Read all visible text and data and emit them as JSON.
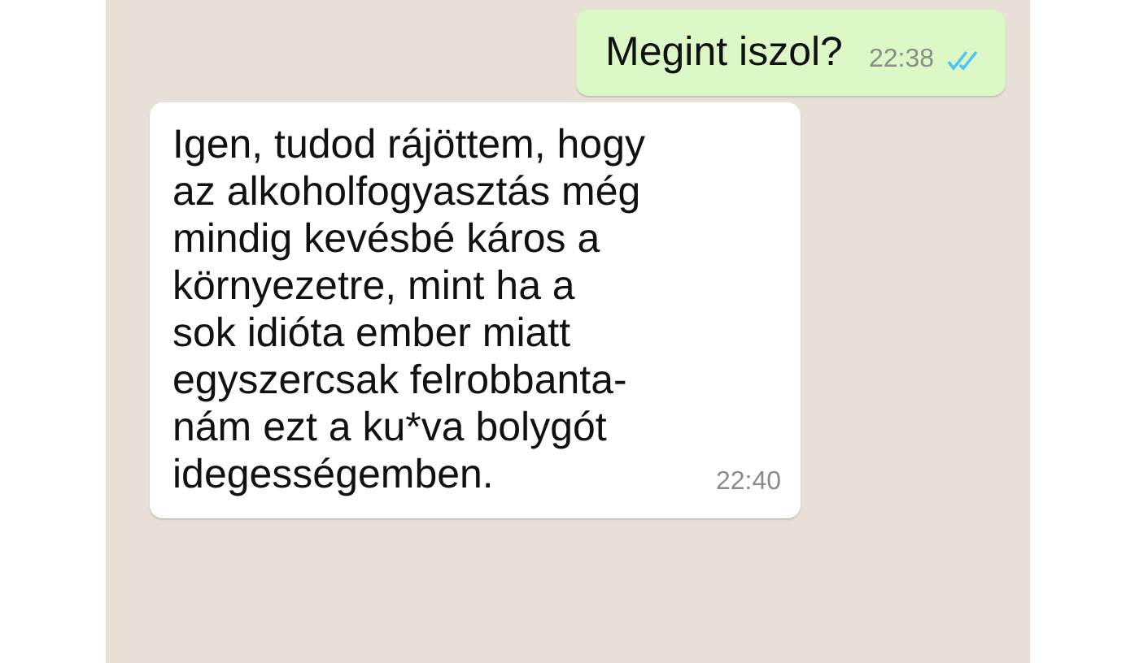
{
  "messages": [
    {
      "kind": "outgoing",
      "lines": [
        "Megint iszol?"
      ],
      "time": "22:38",
      "read": true
    },
    {
      "kind": "incoming",
      "lines": [
        "Igen, tudod rájöttem, hogy",
        "az alkoholfogyasztás még",
        "mindig kevésbé káros a",
        "környezetre, mint ha a",
        "sok idióta ember miatt",
        "egyszercsak felrobbanta-",
        "nám ezt a ku*va bolygót",
        "idegességemben."
      ],
      "time": "22:40"
    }
  ]
}
